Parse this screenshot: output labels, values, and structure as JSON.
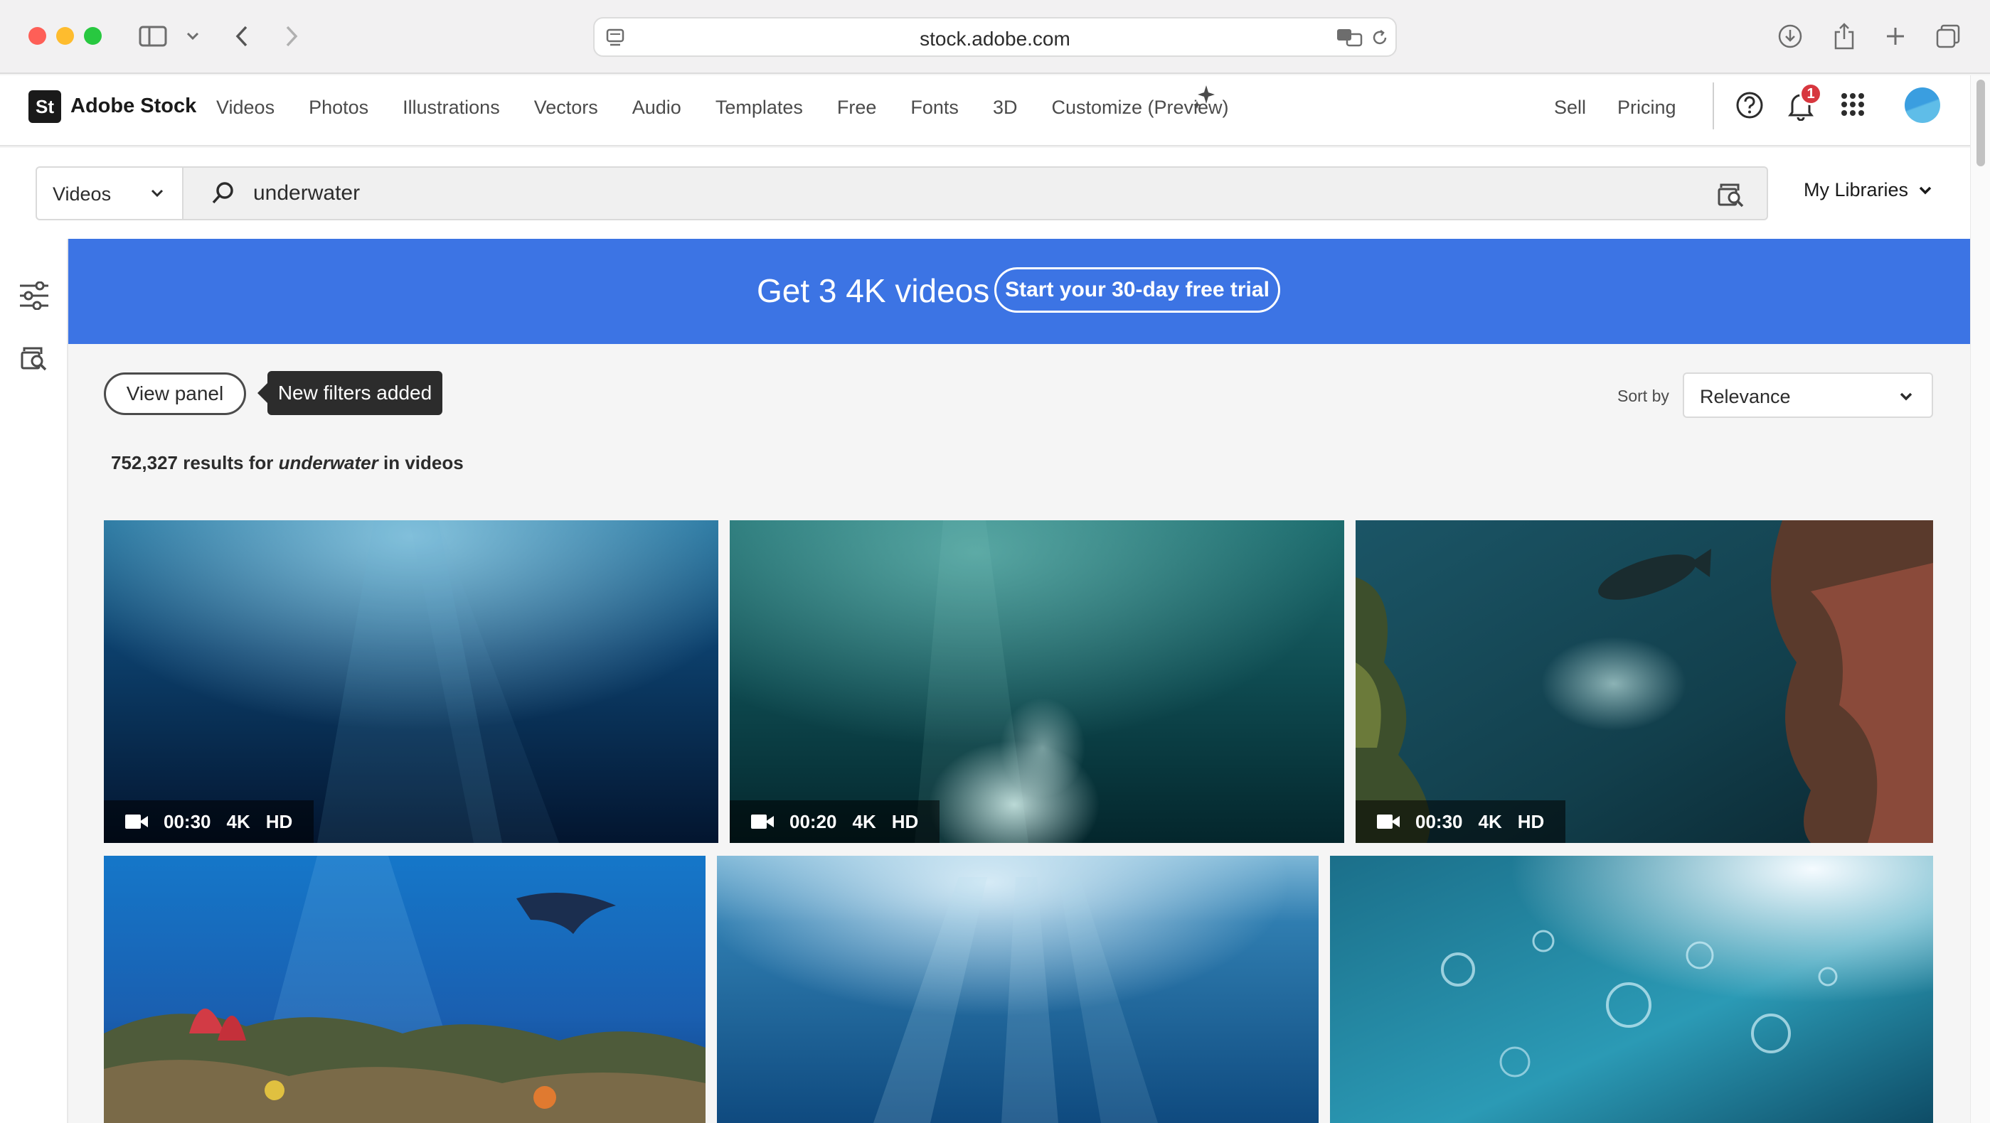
{
  "browser": {
    "url": "stock.adobe.com",
    "icons": [
      "sidebar-toggle-icon",
      "chevron-down-icon",
      "back-icon",
      "forward-icon",
      "translate-icon",
      "reload-icon",
      "download-icon",
      "share-icon",
      "new-tab-icon",
      "tab-overview-icon"
    ]
  },
  "header": {
    "logo_badge": "St",
    "logo_text": "Adobe Stock",
    "nav": [
      "Videos",
      "Photos",
      "Illustrations",
      "Vectors",
      "Audio",
      "Templates",
      "Free",
      "Fonts",
      "3D",
      "Customize (Preview)"
    ],
    "sell": "Sell",
    "pricing": "Pricing",
    "notification_count": "1"
  },
  "search": {
    "type": "Videos",
    "query": "underwater",
    "my_libraries": "My Libraries"
  },
  "banner": {
    "text": "Get 3 4K videos",
    "cta": "Start your 30-day free trial",
    "color": "#3c74e4"
  },
  "controls": {
    "view_panel": "View panel",
    "tooltip": "New filters added",
    "sort_label": "Sort by",
    "sort_value": "Relevance"
  },
  "results": {
    "count": "752,327",
    "mid": "results for",
    "query": "underwater",
    "tail": "in videos"
  },
  "tiles": [
    {
      "duration": "00:30",
      "res": "4K",
      "quality": "HD"
    },
    {
      "duration": "00:20",
      "res": "4K",
      "quality": "HD"
    },
    {
      "duration": "00:30",
      "res": "4K",
      "quality": "HD"
    },
    {},
    {},
    {}
  ]
}
